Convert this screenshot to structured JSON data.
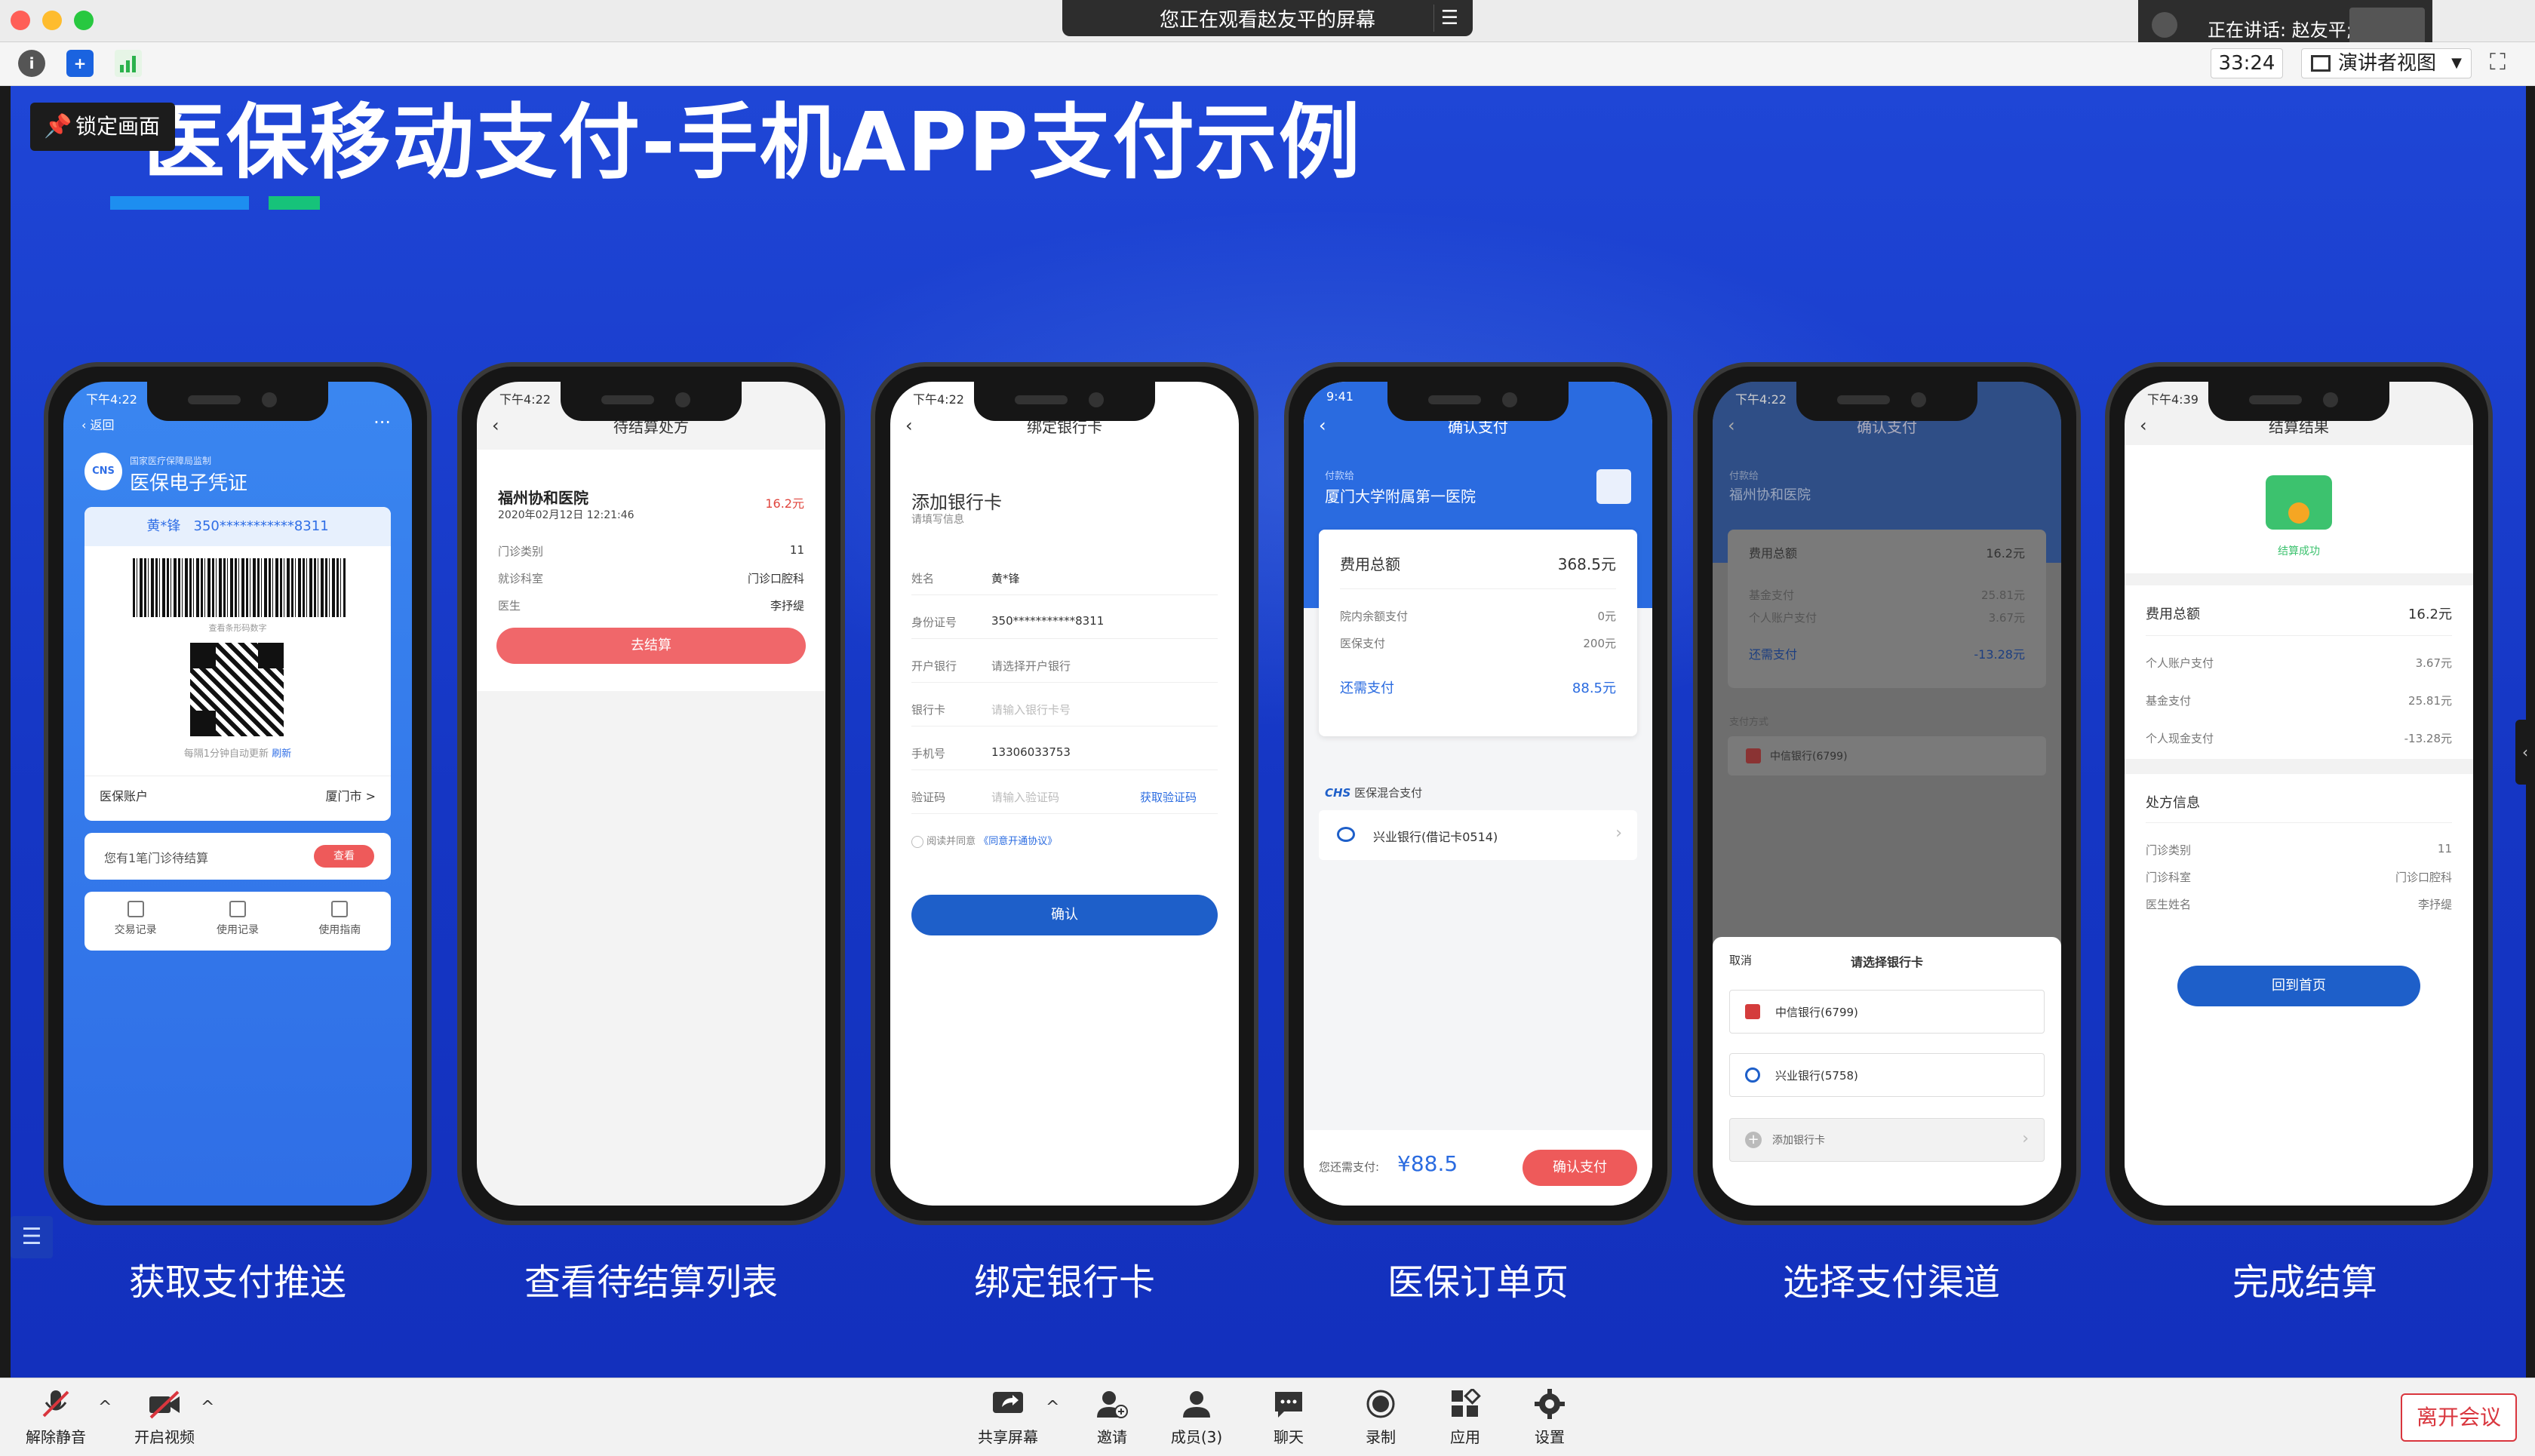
{
  "window": {
    "screen_share_banner": "您正在观看赵友平的屏幕",
    "speaking_label": "正在讲话: 赵友平;",
    "timer": "33:24",
    "view_mode": "演讲者视图",
    "lock_screen_label": "锁定画面"
  },
  "slide": {
    "title": "医保移动支付-手机APP支付示例",
    "captions": [
      "获取支付推送",
      "查看待结算列表",
      "绑定银行卡",
      "医保订单页",
      "选择支付渠道",
      "完成结算"
    ]
  },
  "phone1": {
    "time": "下午4:22",
    "back": "返回",
    "org": "国家医疗保障局监制",
    "title": "医保电子凭证",
    "logo": "CNS",
    "person": "黄*锋",
    "id": "350***********8311",
    "barcode_hint": "查看条形码数字",
    "refresh_hint": "每隔1分钟自动更新",
    "refresh": "刷新",
    "account_label": "医保账户",
    "account_city": "厦门市 >",
    "pending_text": "您有1笔门诊待结算",
    "view_btn": "查看",
    "shortcuts": [
      "交易记录",
      "使用记录",
      "使用指南"
    ]
  },
  "phone2": {
    "time": "下午4:22",
    "header": "待结算处方",
    "hospital": "福州协和医院",
    "datetime": "2020年02月12日 12:21:46",
    "amount": "16.2元",
    "rows": [
      {
        "k": "门诊类别",
        "v": "11"
      },
      {
        "k": "就诊科室",
        "v": "门诊口腔科"
      },
      {
        "k": "医生",
        "v": "李抒缇"
      }
    ],
    "button": "去结算"
  },
  "phone3": {
    "time": "下午4:22",
    "header": "绑定银行卡",
    "title": "添加银行卡",
    "subtitle": "请填写信息",
    "rows": [
      {
        "k": "姓名",
        "v": "黄*锋"
      },
      {
        "k": "身份证号",
        "v": "350***********8311"
      },
      {
        "k": "开户银行",
        "v": "请选择开户银行"
      },
      {
        "k": "银行卡",
        "v": "请输入银行卡号"
      },
      {
        "k": "手机号",
        "v": "13306033753"
      },
      {
        "k": "验证码",
        "v": "请输入验证码"
      }
    ],
    "get_code": "获取验证码",
    "agree": "阅读并同意",
    "agreement": "《同意开通协议》",
    "button": "确认"
  },
  "phone4": {
    "time": "9:41",
    "header": "确认支付",
    "payee_label": "付款给",
    "hospital": "厦门大学附属第一医院",
    "total_label": "费用总额",
    "total": "368.5元",
    "rows": [
      {
        "k": "院内余额支付",
        "v": "0元"
      },
      {
        "k": "医保支付",
        "v": "200元"
      }
    ],
    "remain_label": "还需支付",
    "remain": "88.5元",
    "chs": "CHS",
    "mix_label": "医保混合支付",
    "bank": "兴业银行(借记卡0514)",
    "pay_label": "您还需支付:",
    "pay_amount": "¥88.5",
    "button": "确认支付"
  },
  "phone5": {
    "time": "下午4:22",
    "header": "确认支付",
    "payee_label": "付款给",
    "hospital": "福州协和医院",
    "total_label": "费用总额",
    "total": "16.2元",
    "rows": [
      {
        "k": "基金支付",
        "v": "25.81元"
      },
      {
        "k": "个人账户支付",
        "v": "3.67元"
      }
    ],
    "remain_label": "还需支付",
    "remain": "-13.28元",
    "method_label": "支付方式",
    "method_bank": "中信银行(6799)",
    "cancel": "取消",
    "sheet_title": "请选择银行卡",
    "options": [
      "中信银行(6799)",
      "兴业银行(5758)"
    ],
    "add": "添加银行卡"
  },
  "phone6": {
    "time": "下午4:39",
    "header": "结算结果",
    "success": "结算成功",
    "total_label": "费用总额",
    "total": "16.2元",
    "rows": [
      {
        "k": "个人账户支付",
        "v": "3.67元"
      },
      {
        "k": "基金支付",
        "v": "25.81元"
      },
      {
        "k": "个人现金支付",
        "v": "-13.28元"
      }
    ],
    "rx_title": "处方信息",
    "rx_rows": [
      {
        "k": "门诊类别",
        "v": "11"
      },
      {
        "k": "门诊科室",
        "v": "门诊口腔科"
      },
      {
        "k": "医生姓名",
        "v": "李抒缇"
      }
    ],
    "button": "回到首页"
  },
  "controls": {
    "mute": "解除静音",
    "video": "开启视频",
    "share": "共享屏幕",
    "invite": "邀请",
    "members": "成员(3)",
    "chat": "聊天",
    "record": "录制",
    "apps": "应用",
    "settings": "设置",
    "leave": "离开会议"
  },
  "colors": {
    "slide_blue": "#1f46d6",
    "accent_red": "#d9363e",
    "phone_blue": "#2a6be0",
    "pay_red": "#ee5a5a"
  }
}
